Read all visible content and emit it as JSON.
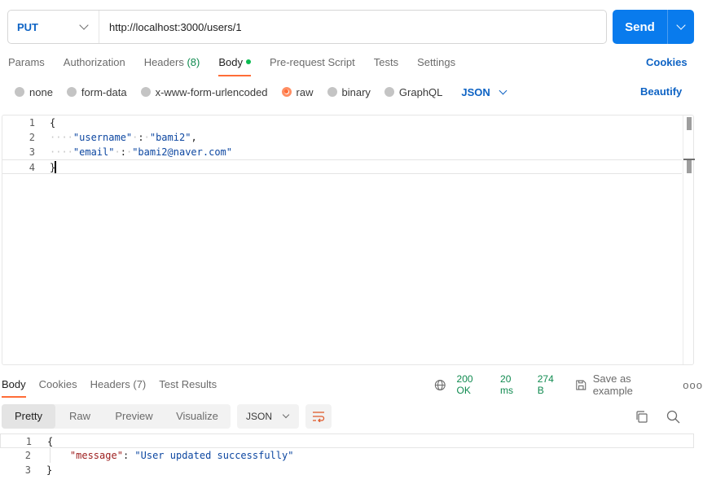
{
  "request": {
    "method": "PUT",
    "url": "http://localhost:3000/users/1",
    "send_label": "Send"
  },
  "request_tabs": [
    {
      "label": "Params"
    },
    {
      "label": "Authorization"
    },
    {
      "label": "Headers",
      "count": "(8)"
    },
    {
      "label": "Body",
      "active": true
    },
    {
      "label": "Pre-request Script"
    },
    {
      "label": "Tests"
    },
    {
      "label": "Settings"
    }
  ],
  "cookies_label": "Cookies",
  "body_types": [
    {
      "label": "none"
    },
    {
      "label": "form-data"
    },
    {
      "label": "x-www-form-urlencoded"
    },
    {
      "label": "raw",
      "selected": true
    },
    {
      "label": "binary"
    },
    {
      "label": "GraphQL"
    }
  ],
  "body_language": "JSON",
  "beautify_label": "Beautify",
  "request_body": {
    "line_numbers": [
      "1",
      "2",
      "3",
      "4"
    ],
    "open_brace": "{",
    "close_brace": "}",
    "username_key": "\"username\"",
    "username_value": "\"bami2\"",
    "email_key": "\"email\"",
    "email_value": "\"bami2@naver.com\""
  },
  "response_tabs": [
    {
      "label": "Body",
      "active": true
    },
    {
      "label": "Cookies"
    },
    {
      "label": "Headers",
      "count": "(7)"
    },
    {
      "label": "Test Results"
    }
  ],
  "response_meta": {
    "status": "200 OK",
    "time": "20 ms",
    "size": "274 B",
    "save_label": "Save as example",
    "more": "ooo"
  },
  "response_views": [
    "Pretty",
    "Raw",
    "Preview",
    "Visualize"
  ],
  "response_language": "JSON",
  "response_body": {
    "line_numbers": [
      "1",
      "2",
      "3"
    ],
    "open_brace": "{",
    "close_brace": "}",
    "message_key": "\"message\"",
    "message_value": "\"User updated successfully\""
  },
  "colors": {
    "accent": "#ff6c37",
    "brand_blue": "#097bed",
    "link_blue": "#0e63c4",
    "status_green": "#0f8a4f"
  }
}
